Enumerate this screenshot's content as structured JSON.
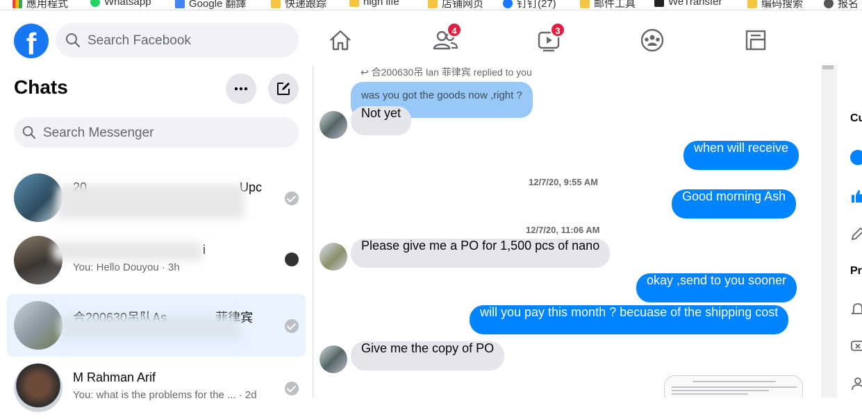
{
  "bookmarks": [
    {
      "label": "應用程式",
      "icon": "apps-grid-icon"
    },
    {
      "label": "Whatsapp",
      "icon": "whatsapp-icon"
    },
    {
      "label": "Google 翻譯",
      "icon": "google-translate-icon"
    },
    {
      "label": "快递跟踪",
      "icon": "folder-icon"
    },
    {
      "label": "high life",
      "icon": "folder-icon"
    },
    {
      "label": "店铺网页",
      "icon": "folder-icon"
    },
    {
      "label": "钉钉(27)",
      "icon": "dingtalk-icon"
    },
    {
      "label": "邮件工具",
      "icon": "folder-icon"
    },
    {
      "label": "WeTransfer",
      "icon": "wetransfer-icon"
    },
    {
      "label": "编码搜索",
      "icon": "folder-icon"
    },
    {
      "label": "报名",
      "icon": "globe-icon"
    }
  ],
  "header": {
    "search_placeholder": "Search Facebook",
    "nav": [
      {
        "name": "home",
        "badge": ""
      },
      {
        "name": "friends",
        "badge": "4"
      },
      {
        "name": "watch",
        "badge": "3"
      },
      {
        "name": "groups",
        "badge": ""
      },
      {
        "name": "gaming",
        "badge": ""
      }
    ]
  },
  "sidebar": {
    "title": "Chats",
    "search_placeholder": "Search Messenger",
    "conversations": [
      {
        "name": "20",
        "name_tail": "Upc",
        "snippet": "",
        "status": "sent"
      },
      {
        "name": "",
        "name_tail": "i",
        "snippet": "You: Hello Douyou · 3h",
        "status": "seen"
      },
      {
        "name": "合200630吊队As",
        "name_tail": "菲律宾",
        "snippet": "",
        "status": "sent",
        "active": true
      },
      {
        "name": "M Rahman Arif",
        "name_tail": "",
        "snippet": "You: what is the problems for the ... · 2d",
        "status": "sent"
      }
    ]
  },
  "chat": {
    "reply_label": "合200630吊         lan 菲律宾 replied to you",
    "messages": [
      {
        "type": "quoted",
        "text": "was you got the goods now ,right ?"
      },
      {
        "type": "in",
        "text": "Not yet"
      },
      {
        "type": "out",
        "text": "when will receive"
      },
      {
        "type": "timestamp",
        "text": "12/7/20, 9:55 AM"
      },
      {
        "type": "out",
        "text": "Good morning Ash"
      },
      {
        "type": "timestamp",
        "text": "12/7/20, 11:06 AM"
      },
      {
        "type": "in",
        "text": "Please give me a PO for 1,500 pcs of nano"
      },
      {
        "type": "out",
        "text": "okay ,send to you sooner"
      },
      {
        "type": "out",
        "text": "will you pay this month ? becuase of the shipping cost"
      },
      {
        "type": "in",
        "text": "Give me the copy of PO"
      }
    ]
  },
  "rightpane": {
    "label_1": "Cu",
    "label_2": "Pr"
  },
  "colors": {
    "brand": "#1877f2",
    "outgoing_bubble": "#0084ff",
    "incoming_bubble": "#e4e6eb",
    "badge": "#e41e3f",
    "active_conversation": "#e7f3ff"
  }
}
